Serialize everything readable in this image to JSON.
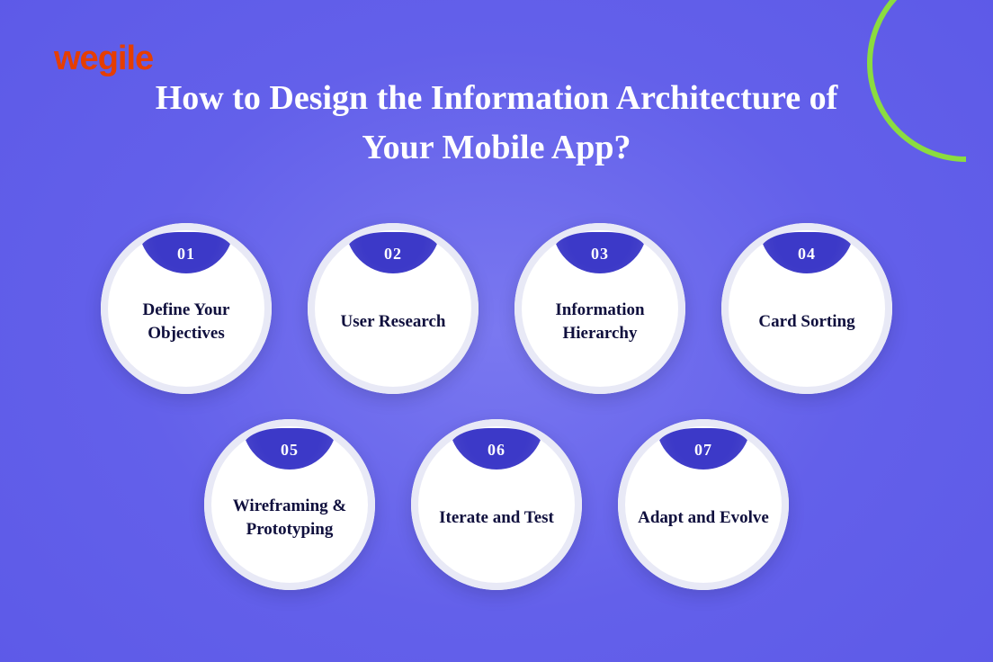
{
  "brand": {
    "logo_text": "wegile"
  },
  "title": "How to Design the Information Architecture of Your Mobile App?",
  "steps": {
    "row1": [
      {
        "num": "01",
        "label": "Define Your Objectives"
      },
      {
        "num": "02",
        "label": "User Research"
      },
      {
        "num": "03",
        "label": "Information Hierarchy"
      },
      {
        "num": "04",
        "label": "Card Sorting"
      }
    ],
    "row2": [
      {
        "num": "05",
        "label": "Wireframing & Prototyping"
      },
      {
        "num": "06",
        "label": "Iterate and Test"
      },
      {
        "num": "07",
        "label": "Adapt and Evolve"
      }
    ]
  }
}
